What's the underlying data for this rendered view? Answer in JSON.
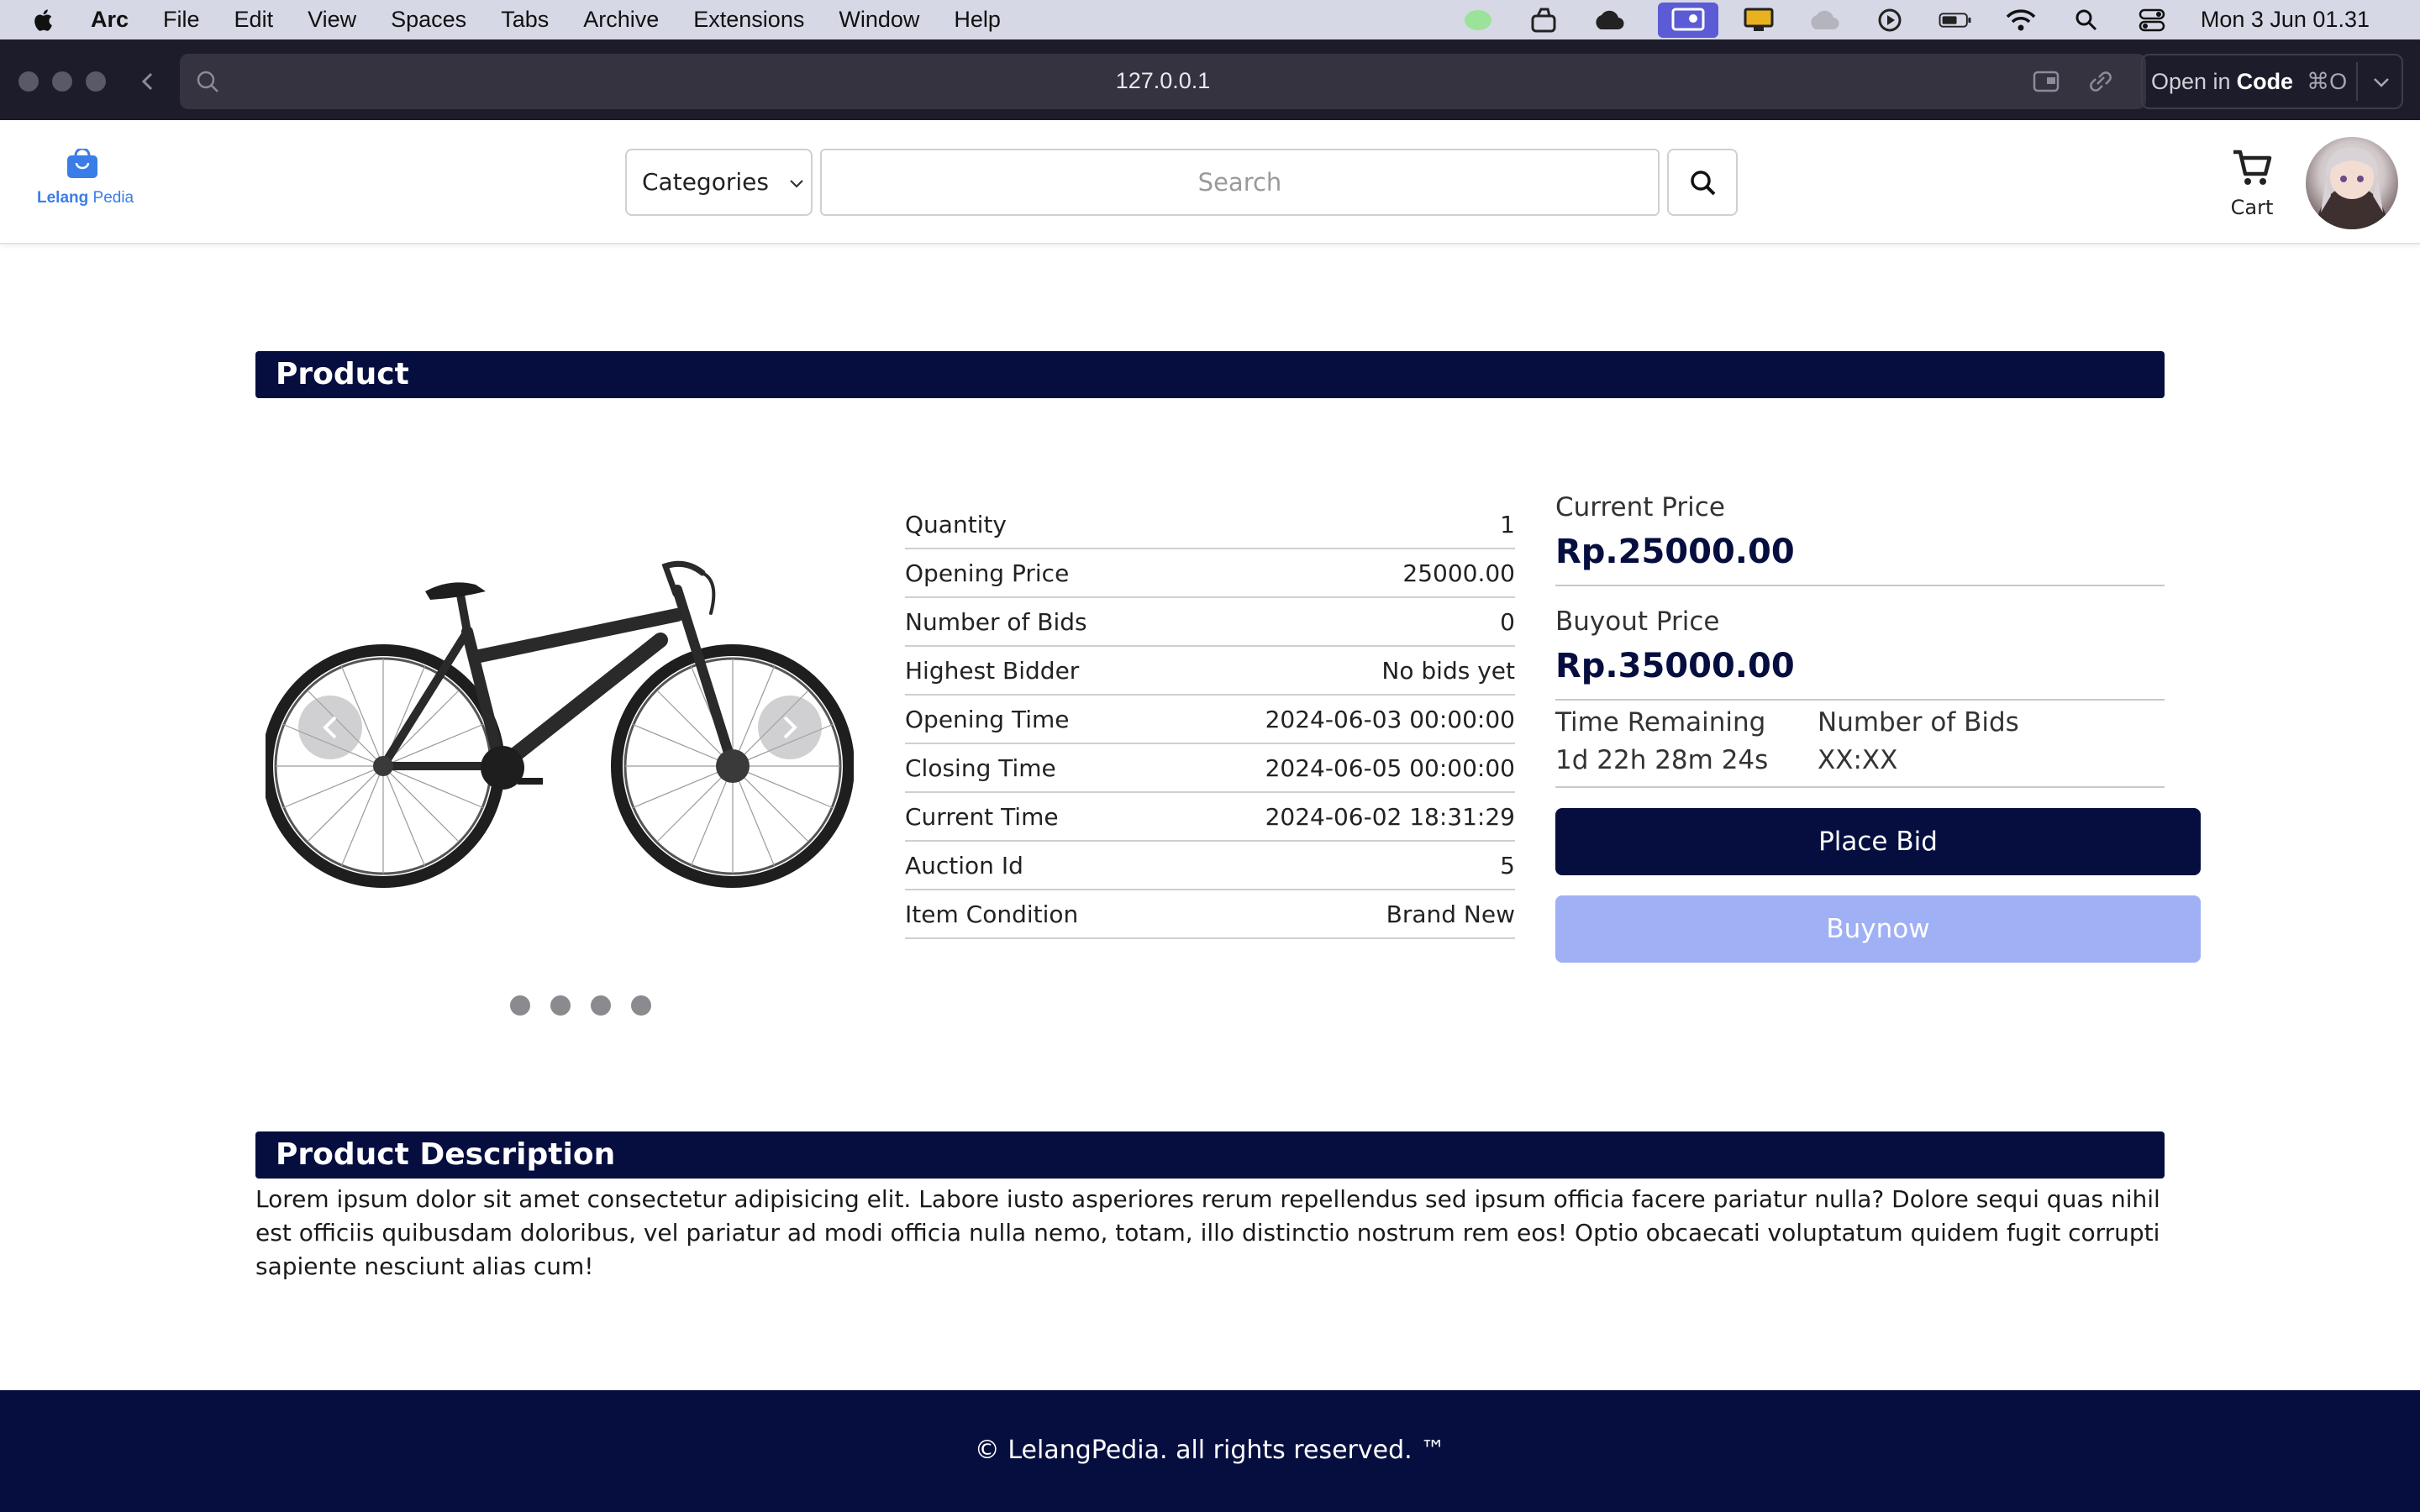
{
  "menubar": {
    "app": "Arc",
    "items": [
      "File",
      "Edit",
      "View",
      "Spaces",
      "Tabs",
      "Archive",
      "Extensions",
      "Window",
      "Help"
    ],
    "clock": "Mon 3 Jun  01.31"
  },
  "browser": {
    "url": "127.0.0.1",
    "open_in": "Open in",
    "open_in_app": "Code",
    "open_in_shortcut": "⌘O"
  },
  "header": {
    "logo_part1": "Lelang",
    "logo_part2": "Pedia",
    "categories_label": "Categories",
    "search_placeholder": "Search",
    "cart_label": "Cart"
  },
  "product": {
    "section_title": "Product",
    "details": [
      {
        "label": "Quantity",
        "value": "1"
      },
      {
        "label": "Opening Price",
        "value": "25000.00"
      },
      {
        "label": "Number of Bids",
        "value": "0"
      },
      {
        "label": "Highest Bidder",
        "value": "No bids yet"
      },
      {
        "label": "Opening Time",
        "value": "2024-06-03 00:00:00"
      },
      {
        "label": "Closing Time",
        "value": "2024-06-05 00:00:00"
      },
      {
        "label": "Current Time",
        "value": "2024-06-02 18:31:29"
      },
      {
        "label": "Auction Id",
        "value": "5"
      },
      {
        "label": "Item Condition",
        "value": "Brand New"
      }
    ],
    "current_price_label": "Current Price",
    "current_price": "Rp.25000.00",
    "buyout_price_label": "Buyout Price",
    "buyout_price": "Rp.35000.00",
    "time_remaining_label": "Time Remaining",
    "time_remaining": "1d 22h 28m 24s",
    "number_of_bids_label": "Number of Bids",
    "number_of_bids": "XX:XX",
    "place_bid_label": "Place Bid",
    "buynow_label": "Buynow",
    "carousel_total": 4
  },
  "description": {
    "section_title": "Product Description",
    "text": "Lorem ipsum dolor sit amet consectetur adipisicing elit. Labore iusto asperiores rerum repellendus sed ipsum officia facere pariatur nulla? Dolore sequi quas nihil est officiis quibusdam doloribus, vel pariatur ad modi officia nulla nemo, totam, illo distinctio nostrum rem eos! Optio obcaecati voluptatum quidem fugit corrupti sapiente nesciunt alias cum!"
  },
  "footer": {
    "text": "© LelangPedia. all rights reserved. ™"
  },
  "colors": {
    "navy": "#050e3f",
    "buynow": "#9fb0f5",
    "logo_blue": "#3b7de8"
  }
}
